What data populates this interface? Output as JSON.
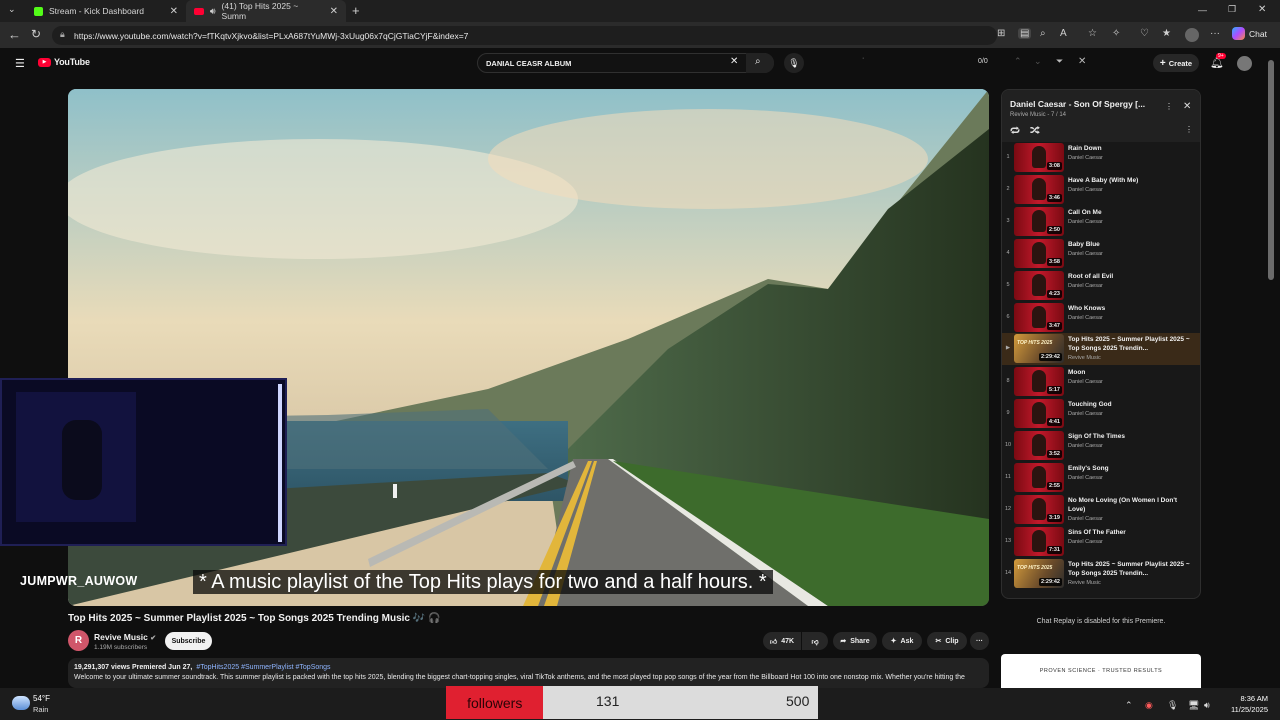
{
  "browser": {
    "tabs": [
      {
        "label": "Stream - Kick Dashboard",
        "icon": "kick-logo-icon",
        "close": "✕"
      },
      {
        "label": "(41) Top Hits 2025 ~ Summ",
        "icon": "youtube-logo-icon",
        "close": "✕",
        "active": true
      }
    ],
    "new_tab": "+",
    "url": "https://www.youtube.com/watch?v=fTKqtvXjkvo&list=PLxA687tYuMWj-3xUug06x7qCjGTiaCYjF&index=7",
    "copilot_label": "Chat",
    "window_controls": [
      "—",
      "❐",
      "✕"
    ]
  },
  "youtube": {
    "logo_text": "YouTube",
    "search_value": "DANIAL CEASR ALBUM",
    "find": {
      "value": "·",
      "count": "0/0"
    },
    "create_label": "Create",
    "notification_badge": "9+"
  },
  "video": {
    "caption": "* A music playlist of the Top Hits plays for two and a half hours. *",
    "streamer_name": "JUMPWR_AUWOW",
    "title": "Top Hits 2025 ~ Summer Playlist 2025 ~ Top Songs 2025 Trending Music 🎶 🎧",
    "channel": {
      "avatar_letter": "R",
      "name": "Revive Music",
      "subscribers": "1.19M subscribers",
      "subscribe_label": "Subscribe"
    },
    "actions": {
      "likes": "47K",
      "share": "Share",
      "ask": "Ask",
      "clip": "Clip",
      "more": "···"
    },
    "description": {
      "meta": "19,291,307 views  Premiered Jun 27,",
      "tags": "#TopHits2025 #SummerPlaylist #TopSongs",
      "text": "Welcome to your ultimate summer soundtrack. This summer playlist is packed with the top hits 2025, blending the biggest chart-topping singles, viral TikTok anthems, and the most played top pop songs of the year from the Billboard Hot 100 into one nonstop mix. Whether you're hitting the"
    }
  },
  "playlist": {
    "title": "Daniel Caesar - Son Of Spergy [...",
    "meta": "Revive Music - 7 / 14",
    "items": [
      {
        "num": "1",
        "title": "Rain Down",
        "artist": "Daniel Caesar",
        "duration": "3:08"
      },
      {
        "num": "2",
        "title": "Have A Baby (With Me)",
        "artist": "Daniel Caesar",
        "duration": "3:46"
      },
      {
        "num": "3",
        "title": "Call On Me",
        "artist": "Daniel Caesar",
        "duration": "2:50"
      },
      {
        "num": "4",
        "title": "Baby Blue",
        "artist": "Daniel Caesar",
        "duration": "3:58"
      },
      {
        "num": "5",
        "title": "Root of all Evil",
        "artist": "Daniel Caesar",
        "duration": "4:23"
      },
      {
        "num": "6",
        "title": "Who Knows",
        "artist": "Daniel Caesar",
        "duration": "3:47"
      },
      {
        "num": "▶",
        "title": "Top Hits 2025 ~ Summer Playlist 2025 ~ Top Songs 2025 Trendin...",
        "artist": "Revive Music",
        "duration": "2:29:42",
        "current": true
      },
      {
        "num": "8",
        "title": "Moon",
        "artist": "Daniel Caesar",
        "duration": "5:17"
      },
      {
        "num": "9",
        "title": "Touching God",
        "artist": "Daniel Caesar",
        "duration": "4:41"
      },
      {
        "num": "10",
        "title": "Sign Of The Times",
        "artist": "Daniel Caesar",
        "duration": "3:52"
      },
      {
        "num": "11",
        "title": "Emily's Song",
        "artist": "Daniel Caesar",
        "duration": "2:55"
      },
      {
        "num": "12",
        "title": "No More Loving (On Women I Don't Love)",
        "artist": "Daniel Caesar",
        "duration": "3:19"
      },
      {
        "num": "13",
        "title": "Sins Of The Father",
        "artist": "Daniel Caesar",
        "duration": "7:31"
      },
      {
        "num": "14",
        "title": "Top Hits 2025 ~ Summer Playlist 2025 ~ Top Songs 2025 Trendin...",
        "artist": "Revive Music",
        "duration": "2:29:42"
      }
    ],
    "thumb_overlay": "TOP HITS 2025"
  },
  "chat_disabled": "Chat Replay is disabled for this Premiere.",
  "ad_text": "PROVEN SCIENCE · TRUSTED RESULTS",
  "overlay": {
    "followers_label": "followers",
    "followers_count": "131",
    "followers_goal": "500",
    "follower_progress": 0.262
  },
  "taskbar": {
    "weather_temp": "54°F",
    "weather_desc": "Rain",
    "time": "8:36 AM",
    "date": "11/25/2025"
  },
  "colors": {
    "youtube_red": "#ff0033",
    "accent_blue": "#3ea6ff",
    "follower_red": "#e02030"
  }
}
